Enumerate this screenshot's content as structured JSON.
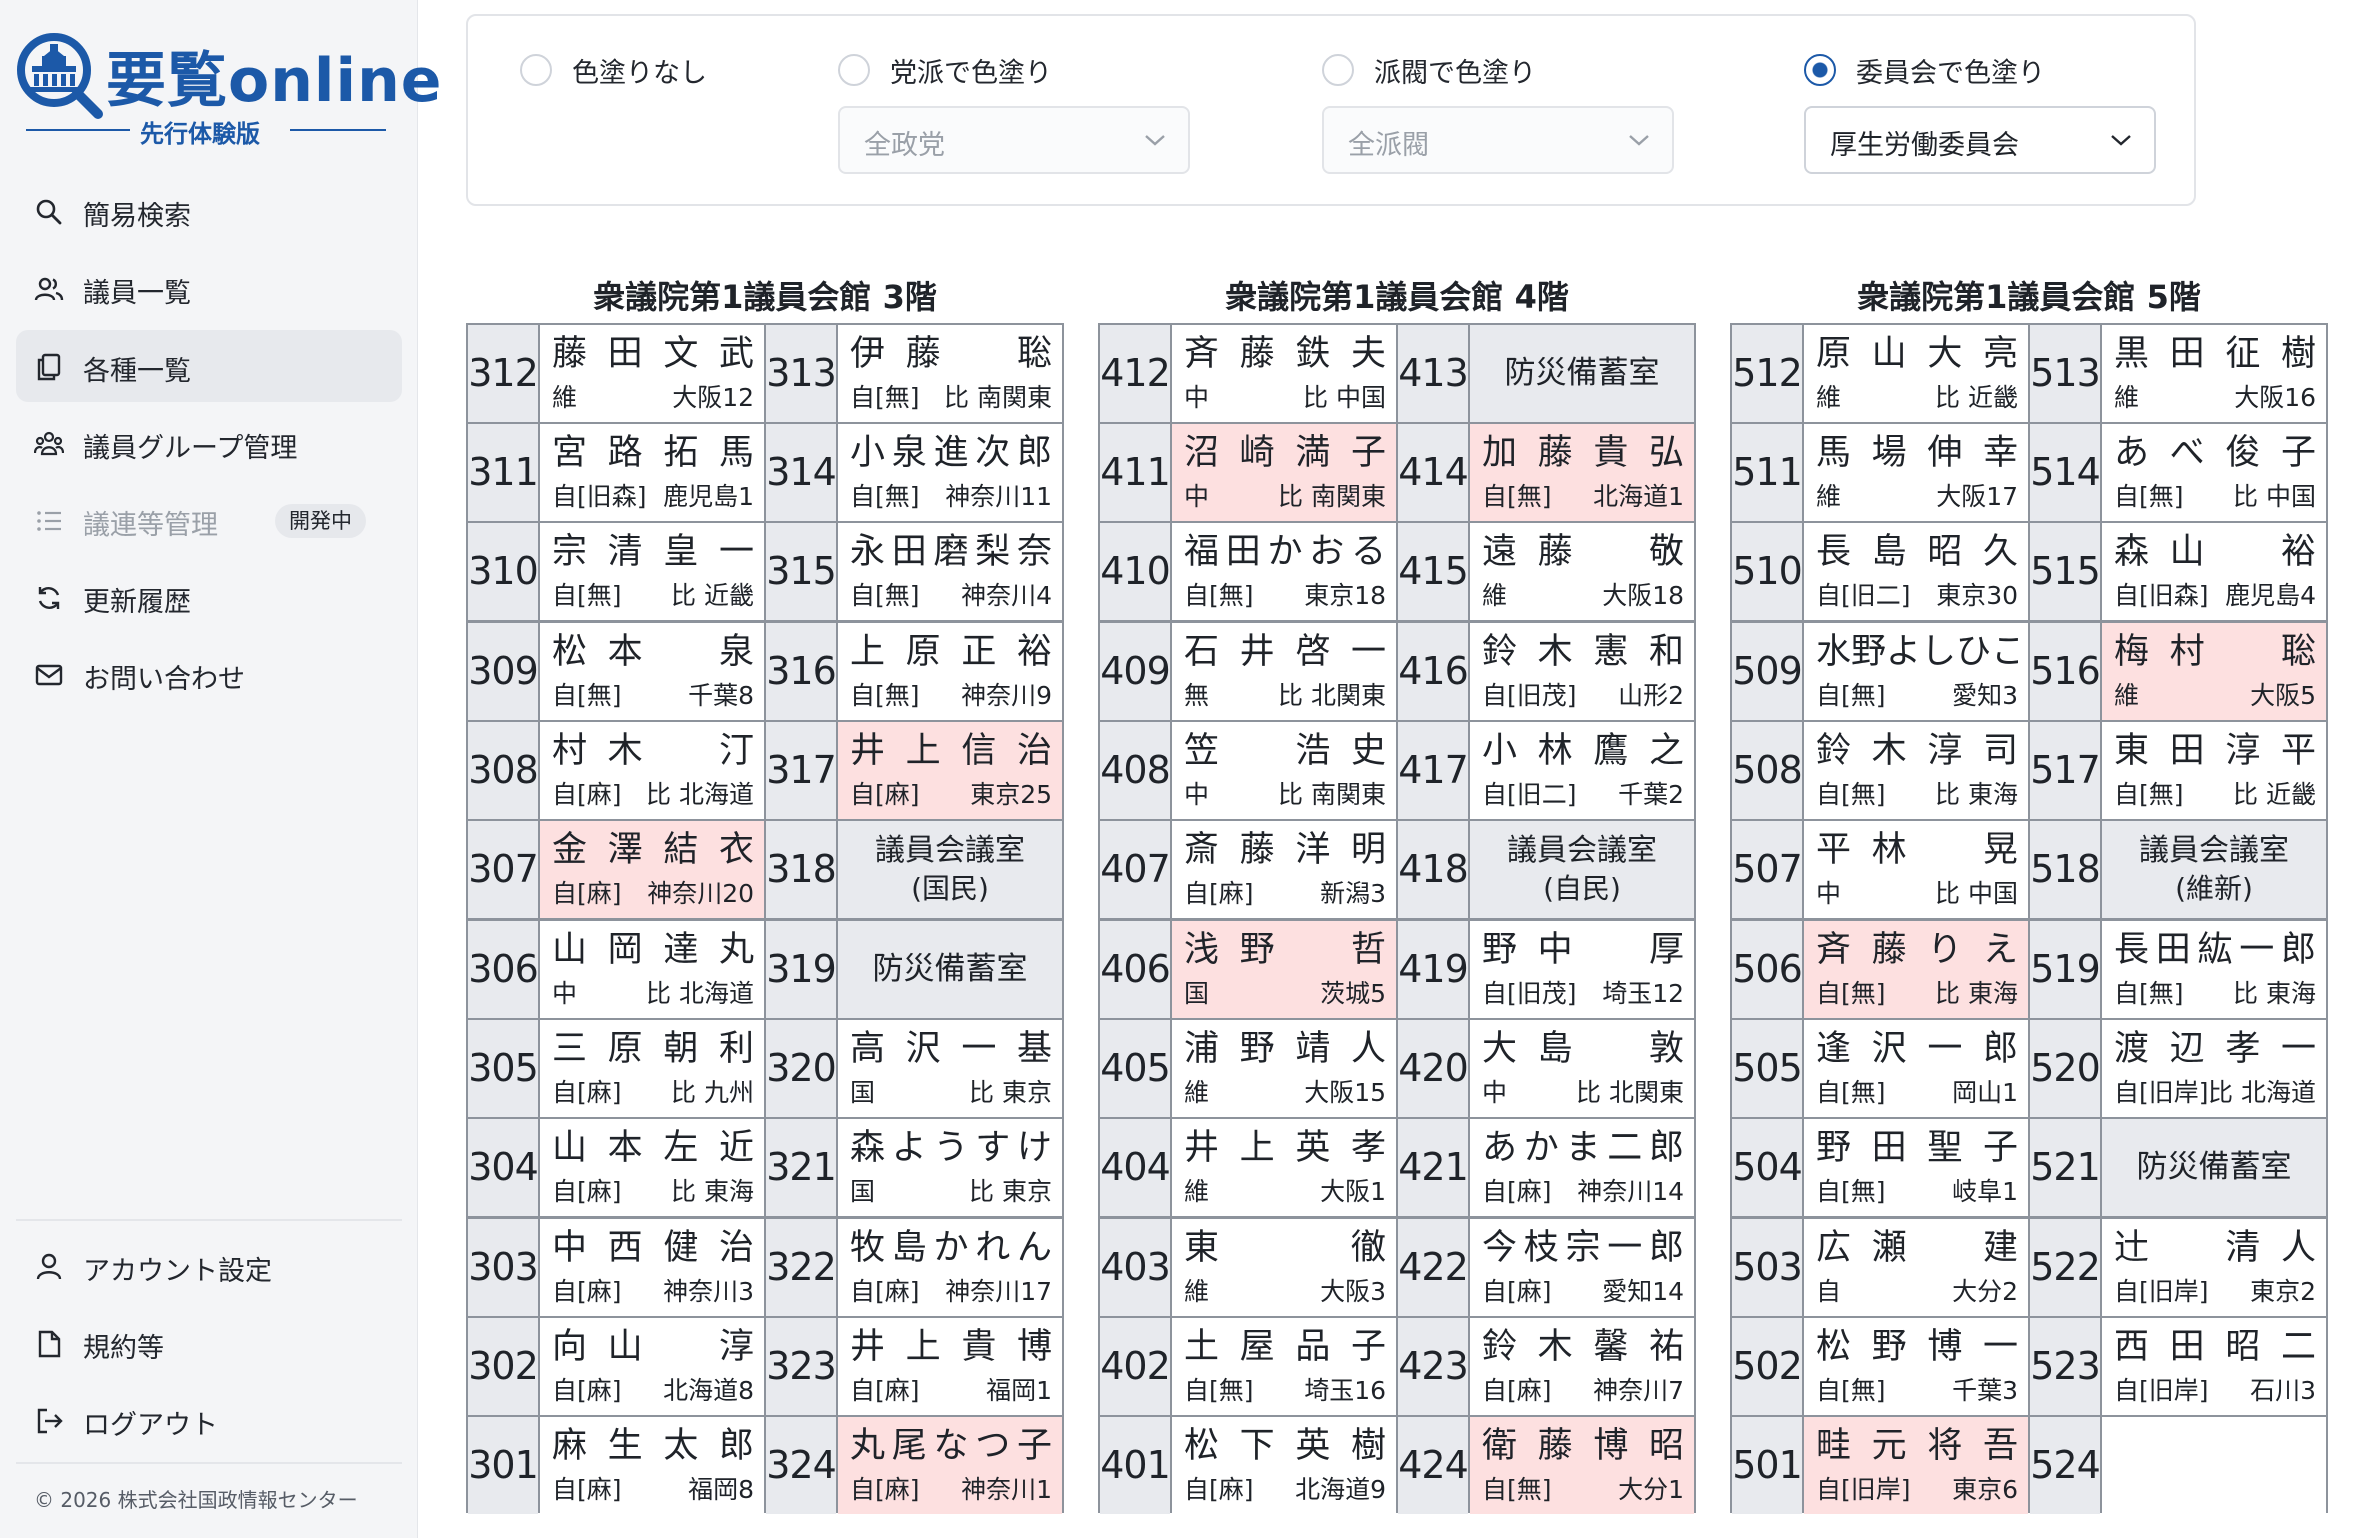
{
  "app": {
    "logo_title": "要覧online",
    "logo_sub": "先行体験版",
    "copyright": "© 2026 株式会社国政情報センター"
  },
  "sidebar": {
    "items": [
      {
        "label": "簡易検索",
        "icon": "search-icon"
      },
      {
        "label": "議員一覧",
        "icon": "users-icon"
      },
      {
        "label": "各種一覧",
        "icon": "copy-icon",
        "active": true
      },
      {
        "label": "議員グループ管理",
        "icon": "group-icon"
      },
      {
        "label": "議連等管理",
        "icon": "list-icon",
        "disabled": true,
        "badge": "開発中"
      },
      {
        "label": "更新履歴",
        "icon": "refresh-icon"
      },
      {
        "label": "お問い合わせ",
        "icon": "mail-icon"
      }
    ],
    "bottom_items": [
      {
        "label": "アカウント設定",
        "icon": "user-icon"
      },
      {
        "label": "規約等",
        "icon": "document-icon"
      },
      {
        "label": "ログアウト",
        "icon": "logout-icon"
      }
    ]
  },
  "filters": {
    "options": [
      {
        "label": "色塗りなし",
        "selected": false
      },
      {
        "label": "党派で色塗り",
        "selected": false,
        "select_value": "全政党"
      },
      {
        "label": "派閥で色塗り",
        "selected": false,
        "select_value": "全派閥"
      },
      {
        "label": "委員会で色塗り",
        "selected": true,
        "select_value": "厚生労働委員会"
      }
    ]
  },
  "colors": {
    "accent": "#1c59a8",
    "highlight": "#fde0e0",
    "room_number_bg": "#e8eaee"
  },
  "floors": [
    {
      "title": "衆議院第1議員会館 3階",
      "rows": [
        [
          {
            "room": "312",
            "name": "藤田文武",
            "party": "維",
            "district": "大阪12"
          },
          {
            "room": "313",
            "name": "伊藤　聡",
            "party": "自[無]",
            "district": "比 南関東"
          }
        ],
        [
          {
            "room": "311",
            "name": "宮路拓馬",
            "party": "自[旧森]",
            "district": "鹿児島1"
          },
          {
            "room": "314",
            "name": "小泉進次郎",
            "party": "自[無]",
            "district": "神奈川11"
          }
        ],
        [
          {
            "room": "310",
            "name": "宗清皇一",
            "party": "自[無]",
            "district": "比 近畿"
          },
          {
            "room": "315",
            "name": "永田磨梨奈",
            "party": "自[無]",
            "district": "神奈川4"
          }
        ],
        [
          {
            "room": "309",
            "name": "松本　泉",
            "party": "自[無]",
            "district": "千葉8"
          },
          {
            "room": "316",
            "name": "上原正裕",
            "party": "自[無]",
            "district": "神奈川9"
          }
        ],
        [
          {
            "room": "308",
            "name": "村木　汀",
            "party": "自[麻]",
            "district": "比 北海道"
          },
          {
            "room": "317",
            "name": "井上信治",
            "party": "自[麻]",
            "district": "東京25",
            "hl": true
          }
        ],
        [
          {
            "room": "307",
            "name": "金澤結衣",
            "party": "自[麻]",
            "district": "神奈川20",
            "hl": true
          },
          {
            "room": "318",
            "facility": "議員会議室",
            "facility_sub": "(国民)"
          }
        ],
        [
          {
            "room": "306",
            "name": "山岡達丸",
            "party": "中",
            "district": "比 北海道"
          },
          {
            "room": "319",
            "facility": "防災備蓄室"
          }
        ],
        [
          {
            "room": "305",
            "name": "三原朝利",
            "party": "自[麻]",
            "district": "比 九州"
          },
          {
            "room": "320",
            "name": "高沢一基",
            "party": "国",
            "district": "比 東京"
          }
        ],
        [
          {
            "room": "304",
            "name": "山本左近",
            "party": "自[麻]",
            "district": "比 東海"
          },
          {
            "room": "321",
            "name": "森ようすけ",
            "party": "国",
            "district": "比 東京"
          }
        ],
        [
          {
            "room": "303",
            "name": "中西健治",
            "party": "自[麻]",
            "district": "神奈川3"
          },
          {
            "room": "322",
            "name": "牧島かれん",
            "party": "自[麻]",
            "district": "神奈川17"
          }
        ],
        [
          {
            "room": "302",
            "name": "向山　淳",
            "party": "自[麻]",
            "district": "北海道8"
          },
          {
            "room": "323",
            "name": "井上貴博",
            "party": "自[麻]",
            "district": "福岡1"
          }
        ],
        [
          {
            "room": "301",
            "name": "麻生太郎",
            "party": "自[麻]",
            "district": "福岡8"
          },
          {
            "room": "324",
            "name": "丸尾なつ子",
            "party": "自[麻]",
            "district": "神奈川1",
            "hl": true
          }
        ]
      ]
    },
    {
      "title": "衆議院第1議員会館 4階",
      "rows": [
        [
          {
            "room": "412",
            "name": "斉藤鉄夫",
            "party": "中",
            "district": "比 中国"
          },
          {
            "room": "413",
            "facility": "防災備蓄室"
          }
        ],
        [
          {
            "room": "411",
            "name": "沼崎満子",
            "party": "中",
            "district": "比 南関東",
            "hl": true
          },
          {
            "room": "414",
            "name": "加藤貴弘",
            "party": "自[無]",
            "district": "北海道1",
            "hl": true
          }
        ],
        [
          {
            "room": "410",
            "name": "福田かおる",
            "party": "自[無]",
            "district": "東京18"
          },
          {
            "room": "415",
            "name": "遠藤　敬",
            "party": "維",
            "district": "大阪18"
          }
        ],
        [
          {
            "room": "409",
            "name": "石井啓一",
            "party": "無",
            "district": "比 北関東"
          },
          {
            "room": "416",
            "name": "鈴木憲和",
            "party": "自[旧茂]",
            "district": "山形2"
          }
        ],
        [
          {
            "room": "408",
            "name": "笠　浩史",
            "party": "中",
            "district": "比 南関東"
          },
          {
            "room": "417",
            "name": "小林鷹之",
            "party": "自[旧二]",
            "district": "千葉2"
          }
        ],
        [
          {
            "room": "407",
            "name": "斎藤洋明",
            "party": "自[麻]",
            "district": "新潟3"
          },
          {
            "room": "418",
            "facility": "議員会議室",
            "facility_sub": "(自民)"
          }
        ],
        [
          {
            "room": "406",
            "name": "浅野　哲",
            "party": "国",
            "district": "茨城5",
            "hl": true
          },
          {
            "room": "419",
            "name": "野中　厚",
            "party": "自[旧茂]",
            "district": "埼玉12"
          }
        ],
        [
          {
            "room": "405",
            "name": "浦野靖人",
            "party": "維",
            "district": "大阪15"
          },
          {
            "room": "420",
            "name": "大島　敦",
            "party": "中",
            "district": "比 北関東"
          }
        ],
        [
          {
            "room": "404",
            "name": "井上英孝",
            "party": "維",
            "district": "大阪1"
          },
          {
            "room": "421",
            "name": "あかま二郎",
            "party": "自[麻]",
            "district": "神奈川14"
          }
        ],
        [
          {
            "room": "403",
            "name": "東　徹",
            "party": "維",
            "district": "大阪3"
          },
          {
            "room": "422",
            "name": "今枝宗一郎",
            "party": "自[麻]",
            "district": "愛知14"
          }
        ],
        [
          {
            "room": "402",
            "name": "土屋品子",
            "party": "自[無]",
            "district": "埼玉16"
          },
          {
            "room": "423",
            "name": "鈴木馨祐",
            "party": "自[麻]",
            "district": "神奈川7"
          }
        ],
        [
          {
            "room": "401",
            "name": "松下英樹",
            "party": "自[麻]",
            "district": "北海道9"
          },
          {
            "room": "424",
            "name": "衛藤博昭",
            "party": "自[無]",
            "district": "大分1",
            "hl": true
          }
        ]
      ]
    },
    {
      "title": "衆議院第1議員会館 5階",
      "rows": [
        [
          {
            "room": "512",
            "name": "原山大亮",
            "party": "維",
            "district": "比 近畿"
          },
          {
            "room": "513",
            "name": "黒田征樹",
            "party": "維",
            "district": "大阪16"
          }
        ],
        [
          {
            "room": "511",
            "name": "馬場伸幸",
            "party": "維",
            "district": "大阪17"
          },
          {
            "room": "514",
            "name": "あべ俊子",
            "party": "自[無]",
            "district": "比 中国"
          }
        ],
        [
          {
            "room": "510",
            "name": "長島昭久",
            "party": "自[旧二]",
            "district": "東京30"
          },
          {
            "room": "515",
            "name": "森山　裕",
            "party": "自[旧森]",
            "district": "鹿児島4"
          }
        ],
        [
          {
            "room": "509",
            "name": "水野よしひこ",
            "party": "自[無]",
            "district": "愛知3"
          },
          {
            "room": "516",
            "name": "梅村　聡",
            "party": "維",
            "district": "大阪5",
            "hl": true
          }
        ],
        [
          {
            "room": "508",
            "name": "鈴木淳司",
            "party": "自[無]",
            "district": "比 東海"
          },
          {
            "room": "517",
            "name": "東田淳平",
            "party": "自[無]",
            "district": "比 近畿"
          }
        ],
        [
          {
            "room": "507",
            "name": "平林　晃",
            "party": "中",
            "district": "比 中国"
          },
          {
            "room": "518",
            "facility": "議員会議室",
            "facility_sub": "(維新)"
          }
        ],
        [
          {
            "room": "506",
            "name": "斉藤りえ",
            "party": "自[無]",
            "district": "比 東海",
            "hl": true
          },
          {
            "room": "519",
            "name": "長田紘一郎",
            "party": "自[無]",
            "district": "比 東海"
          }
        ],
        [
          {
            "room": "505",
            "name": "逢沢一郎",
            "party": "自[無]",
            "district": "岡山1"
          },
          {
            "room": "520",
            "name": "渡辺孝一",
            "party": "自[旧岸]",
            "district": "比 北海道"
          }
        ],
        [
          {
            "room": "504",
            "name": "野田聖子",
            "party": "自[無]",
            "district": "岐阜1"
          },
          {
            "room": "521",
            "facility": "防災備蓄室"
          }
        ],
        [
          {
            "room": "503",
            "name": "広瀬　建",
            "party": "自",
            "district": "大分2"
          },
          {
            "room": "522",
            "name": "辻　清人",
            "party": "自[旧岸]",
            "district": "東京2"
          }
        ],
        [
          {
            "room": "502",
            "name": "松野博一",
            "party": "自[無]",
            "district": "千葉3"
          },
          {
            "room": "523",
            "name": "西田昭二",
            "party": "自[旧岸]",
            "district": "石川3"
          }
        ],
        [
          {
            "room": "501",
            "name": "畦元将吾",
            "party": "自[旧岸]",
            "district": "東京6",
            "hl": true
          },
          {
            "room": "524",
            "empty": true
          }
        ]
      ]
    }
  ]
}
